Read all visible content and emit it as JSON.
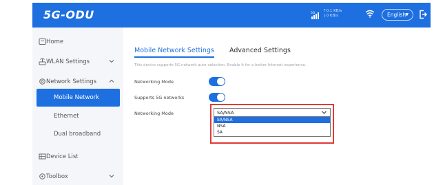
{
  "header": {
    "logo": "5G-ODU",
    "upload_rate": "↑0.1 KB/s",
    "download_rate": "↓0 KB/s",
    "language": "English",
    "signal_icon": "signal-5g-icon",
    "wifi_icon": "wifi-icon",
    "logout_icon": "logout-icon",
    "bg_color": "#1e6fe0"
  },
  "sidebar": {
    "items": [
      {
        "label": "Home",
        "icon": "home-icon"
      },
      {
        "label": "WLAN Settings",
        "icon": "wlan-icon",
        "expanded": false
      },
      {
        "label": "Network Settings",
        "icon": "network-settings-icon",
        "expanded": true
      },
      {
        "label": "Device List",
        "icon": "device-list-icon"
      },
      {
        "label": "Toolbox",
        "icon": "toolbox-icon",
        "expanded": false
      }
    ],
    "sub_items": [
      {
        "label": "Mobile Network",
        "active": true
      },
      {
        "label": "Ethernet",
        "active": false
      },
      {
        "label": "Dual broadband",
        "active": false
      }
    ]
  },
  "main": {
    "tabs": [
      {
        "label": "Mobile Network Settings",
        "active": true
      },
      {
        "label": "Advanced Settings",
        "active": false
      }
    ],
    "note": "This device supports 5G network auto-selection. Enable it for a better Internet experience.",
    "rows": [
      {
        "label": "Networking Mode",
        "toggle_on": true
      },
      {
        "label": "Supports 5G networks",
        "toggle_on": true
      }
    ],
    "mode_select": {
      "label": "Networking Mode",
      "value": "SA/NSA",
      "options": [
        "SA/NSA",
        "NSA",
        "SA"
      ],
      "highlighted_option": "SA/NSA"
    },
    "highlight_color": "#e23a36"
  }
}
